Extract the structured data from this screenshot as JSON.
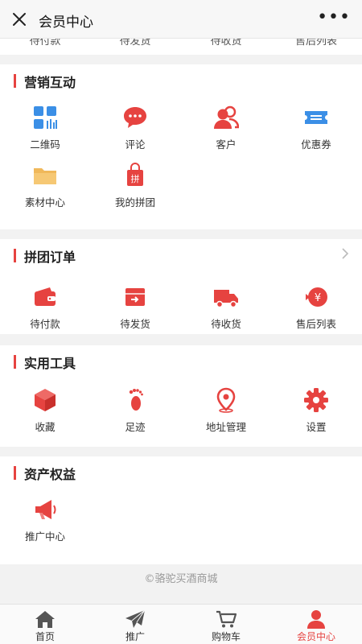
{
  "topbar": {
    "title": "会员中心",
    "more": "•••"
  },
  "order_clip": [
    "待付款",
    "待发货",
    "待收货",
    "售后列表"
  ],
  "marketing": {
    "title": "营销互动",
    "items": [
      {
        "label": "二维码",
        "icon": "qrcode-icon"
      },
      {
        "label": "评论",
        "icon": "comment-icon"
      },
      {
        "label": "客户",
        "icon": "customers-icon"
      },
      {
        "label": "优惠券",
        "icon": "coupon-icon"
      },
      {
        "label": "素材中心",
        "icon": "folder-icon"
      },
      {
        "label": "我的拼团",
        "icon": "group-buy-bag-icon"
      }
    ]
  },
  "group_orders": {
    "title": "拼团订单",
    "items": [
      {
        "label": "待付款",
        "icon": "wallet-icon"
      },
      {
        "label": "待发货",
        "icon": "ship-box-icon"
      },
      {
        "label": "待收货",
        "icon": "truck-icon"
      },
      {
        "label": "售后列表",
        "icon": "refund-icon"
      }
    ]
  },
  "tools": {
    "title": "实用工具",
    "items": [
      {
        "label": "收藏",
        "icon": "favorite-box-icon"
      },
      {
        "label": "足迹",
        "icon": "footprint-icon"
      },
      {
        "label": "地址管理",
        "icon": "location-pin-icon"
      },
      {
        "label": "设置",
        "icon": "gear-icon"
      }
    ]
  },
  "assets": {
    "title": "资产权益",
    "items": [
      {
        "label": "推广中心",
        "icon": "megaphone-icon"
      }
    ]
  },
  "footer": "©骆驼买酒商城",
  "tabbar": {
    "active": 3,
    "items": [
      {
        "label": "首页",
        "icon": "home-icon"
      },
      {
        "label": "推广",
        "icon": "send-icon"
      },
      {
        "label": "购物车",
        "icon": "cart-icon"
      },
      {
        "label": "会员中心",
        "icon": "user-icon"
      }
    ]
  },
  "colors": {
    "accent": "#e64340",
    "blue": "#3b8fe6",
    "orange": "#f0b85a"
  }
}
